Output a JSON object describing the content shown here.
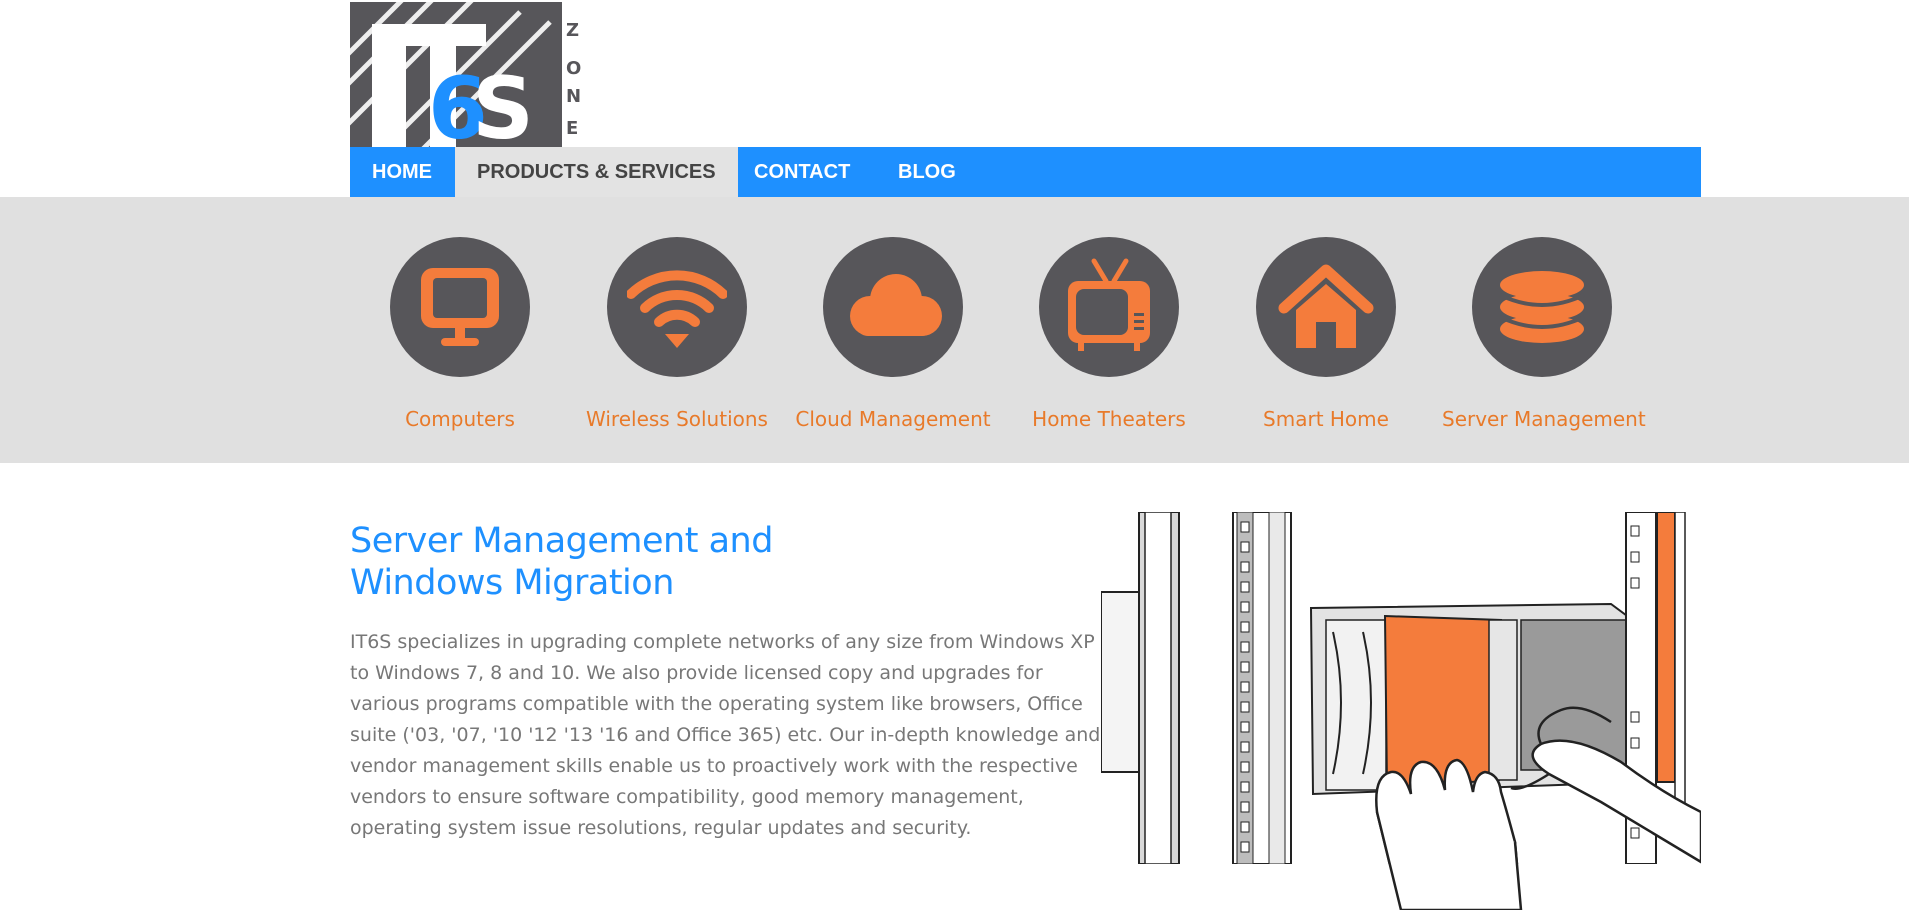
{
  "logo": {
    "text": "IT6S",
    "sub_text": "ZONE",
    "colors": {
      "dark": "#57565a",
      "blue": "#1e90ff"
    }
  },
  "nav": {
    "items": [
      {
        "label": "HOME",
        "active": false
      },
      {
        "label": "PRODUCTS & SERVICES",
        "active": true
      },
      {
        "label": "CONTACT",
        "active": false
      },
      {
        "label": "BLOG",
        "active": false
      }
    ]
  },
  "services": {
    "items": [
      {
        "label": "Computers",
        "icon": "monitor-icon"
      },
      {
        "label": "Wireless Solutions",
        "icon": "wifi-icon"
      },
      {
        "label": "Cloud Management",
        "icon": "cloud-icon"
      },
      {
        "label": "Home Theaters",
        "icon": "tv-icon"
      },
      {
        "label": "Smart Home",
        "icon": "house-icon"
      },
      {
        "label": "Server Management",
        "icon": "database-icon"
      }
    ]
  },
  "content": {
    "title_line1": "Server Management and",
    "title_line2": "Windows Migration",
    "body": "IT6S specializes in upgrading complete networks of any size from Windows XP to Windows 7, 8 and 10. We also provide licensed copy and upgrades for various programs compatible with the operating system like browsers, Office suite ('03, '07, '10 '12 '13 '16 and Office 365) etc. Our in-depth knowledge and vendor management skills enable us to proactively work with the respective vendors to ensure software compatibility, good memory management, operating system issue resolutions, regular updates and security.",
    "illustration": "server-rack-illustration"
  },
  "colors": {
    "nav_blue": "#1e90ff",
    "accent_orange": "#f47c3c",
    "label_orange": "#e87a2a",
    "icon_circle": "#57565a",
    "band_gray": "#e0e0e0",
    "text_gray": "#777777"
  }
}
